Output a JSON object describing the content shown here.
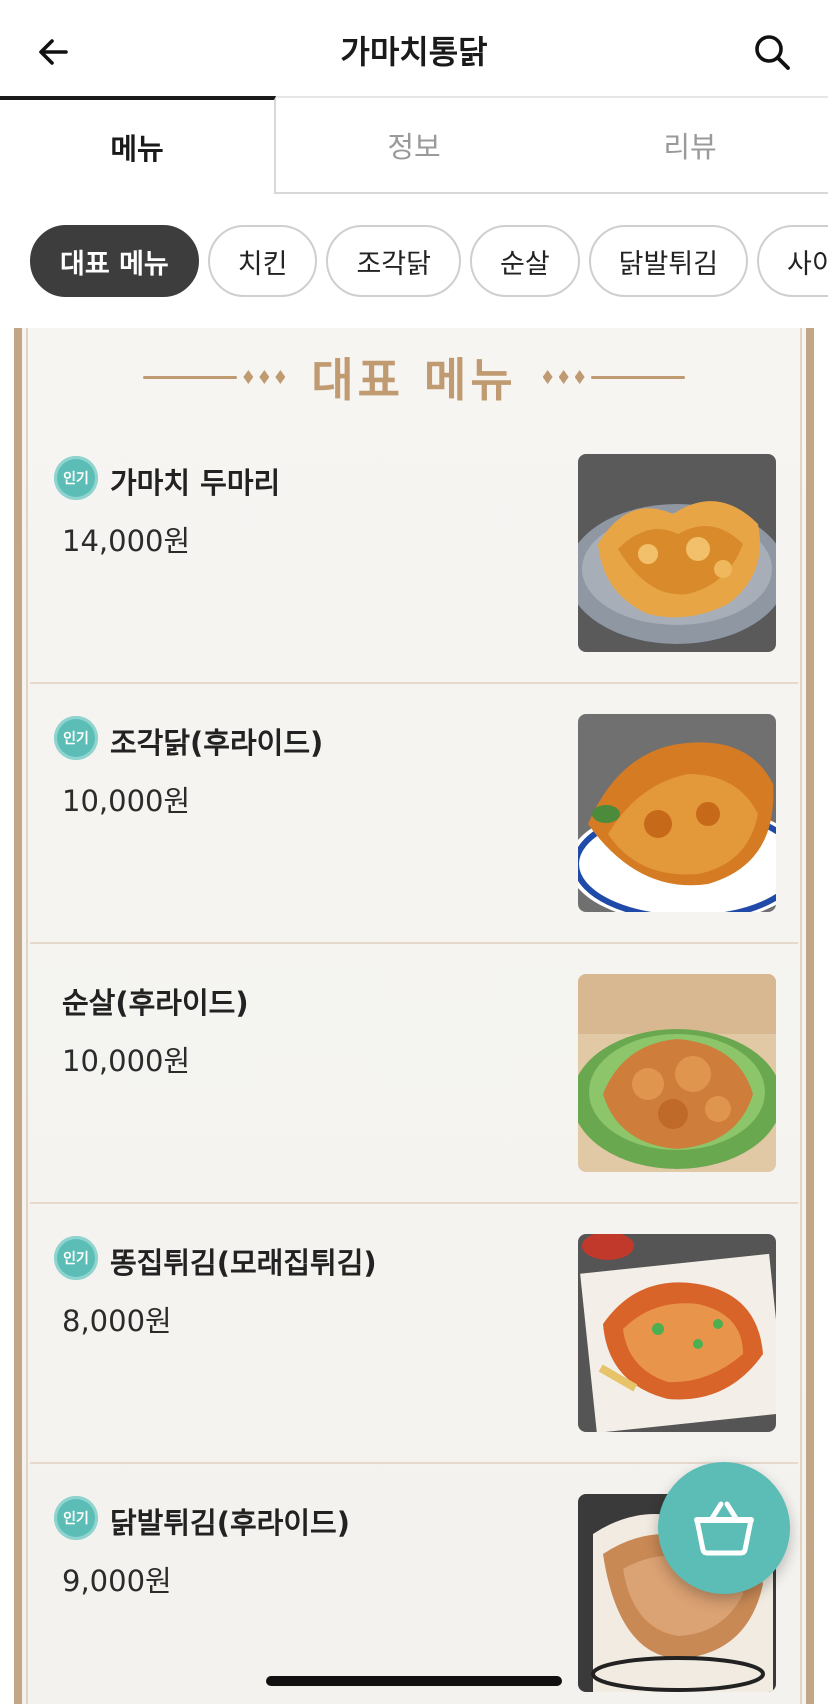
{
  "header": {
    "title": "가마치통닭",
    "back_icon": "arrow-left-icon",
    "search_icon": "search-icon"
  },
  "tabs": [
    {
      "label": "메뉴",
      "active": true
    },
    {
      "label": "정보",
      "active": false
    },
    {
      "label": "리뷰",
      "active": false
    }
  ],
  "chips": [
    {
      "label": "대표 메뉴",
      "active": true
    },
    {
      "label": "치킨",
      "active": false
    },
    {
      "label": "조각닭",
      "active": false
    },
    {
      "label": "순살",
      "active": false
    },
    {
      "label": "닭발튀김",
      "active": false
    },
    {
      "label": "사이드",
      "active": false
    }
  ],
  "board": {
    "title": "대표 메뉴"
  },
  "items": [
    {
      "badge": "인기",
      "name": "가마치 두마리",
      "price": "14,000원",
      "image": "whole-fried-chicken"
    },
    {
      "badge": "인기",
      "name": "조각닭(후라이드)",
      "price": "10,000원",
      "image": "chicken-pieces"
    },
    {
      "badge": "",
      "name": "순살(후라이드)",
      "price": "10,000원",
      "image": "boneless-chicken"
    },
    {
      "badge": "인기",
      "name": "똥집튀김(모래집튀김)",
      "price": "8,000원",
      "image": "fried-gizzards"
    },
    {
      "badge": "인기",
      "name": "닭발튀김(후라이드)",
      "price": "9,000원",
      "image": "fried-chicken-feet"
    }
  ],
  "colors": {
    "accent_teal": "#5bbdb5",
    "board_border": "#c2a688",
    "board_title": "#c09a70",
    "chip_active_bg": "#3d3d3d"
  },
  "cart": {
    "icon": "basket-icon"
  }
}
